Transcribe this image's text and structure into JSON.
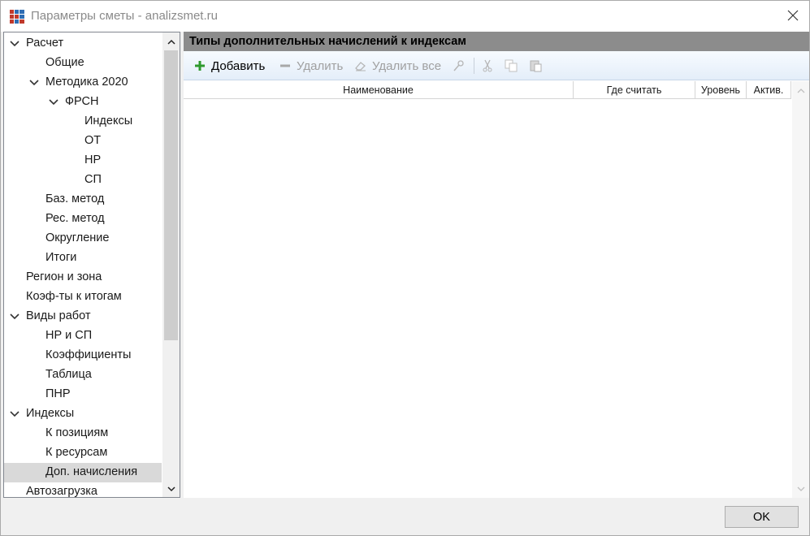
{
  "window": {
    "title": "Параметры сметы - analizsmet.ru",
    "app_icon": "table-grid-icon",
    "close_icon": "close-icon"
  },
  "tree": {
    "items": [
      {
        "label": "Расчет",
        "level": 0,
        "expandable": true,
        "expanded": true,
        "selected": false
      },
      {
        "label": "Общие",
        "level": 1,
        "expandable": false,
        "selected": false
      },
      {
        "label": "Методика 2020",
        "level": 1,
        "expandable": true,
        "expanded": true,
        "selected": false
      },
      {
        "label": "ФРСН",
        "level": 2,
        "expandable": true,
        "expanded": true,
        "selected": false
      },
      {
        "label": "Индексы",
        "level": 3,
        "expandable": false,
        "selected": false
      },
      {
        "label": "ОТ",
        "level": 3,
        "expandable": false,
        "selected": false
      },
      {
        "label": "НР",
        "level": 3,
        "expandable": false,
        "selected": false
      },
      {
        "label": "СП",
        "level": 3,
        "expandable": false,
        "selected": false
      },
      {
        "label": "Баз. метод",
        "level": 1,
        "expandable": false,
        "selected": false
      },
      {
        "label": "Рес. метод",
        "level": 1,
        "expandable": false,
        "selected": false
      },
      {
        "label": "Округление",
        "level": 1,
        "expandable": false,
        "selected": false
      },
      {
        "label": "Итоги",
        "level": 1,
        "expandable": false,
        "selected": false
      },
      {
        "label": "Регион и зона",
        "level": 0,
        "expandable": false,
        "selected": false
      },
      {
        "label": "Коэф-ты к итогам",
        "level": 0,
        "expandable": false,
        "selected": false
      },
      {
        "label": "Виды работ",
        "level": 0,
        "expandable": true,
        "expanded": true,
        "selected": false
      },
      {
        "label": "НР и СП",
        "level": 1,
        "expandable": false,
        "selected": false
      },
      {
        "label": "Коэффициенты",
        "level": 1,
        "expandable": false,
        "selected": false
      },
      {
        "label": "Таблица",
        "level": 1,
        "expandable": false,
        "selected": false
      },
      {
        "label": "ПНР",
        "level": 1,
        "expandable": false,
        "selected": false
      },
      {
        "label": "Индексы",
        "level": 0,
        "expandable": true,
        "expanded": true,
        "selected": false
      },
      {
        "label": "К позициям",
        "level": 1,
        "expandable": false,
        "selected": false
      },
      {
        "label": "К ресурсам",
        "level": 1,
        "expandable": false,
        "selected": false
      },
      {
        "label": "Доп. начисления",
        "level": 1,
        "expandable": false,
        "selected": true
      },
      {
        "label": "Автозагрузка",
        "level": 0,
        "expandable": false,
        "selected": false
      }
    ]
  },
  "panel": {
    "header": "Типы дополнительных начислений к индексам",
    "toolbar": {
      "add_label": "Добавить",
      "delete_label": "Удалить",
      "delete_all_label": "Удалить все",
      "add_icon": "plus-icon",
      "delete_icon": "minus-icon",
      "delete_all_icon": "eraser-icon",
      "clear_format_icon": "brush-icon",
      "cut_icon": "scissors-icon",
      "copy_icon": "copy-icon",
      "paste_icon": "paste-icon"
    },
    "columns": [
      "Наименование",
      "Где считать",
      "Уровень",
      "Актив."
    ],
    "rows": []
  },
  "footer": {
    "ok_label": "OK"
  },
  "colors": {
    "header_bg": "#8c8c8c",
    "selected_bg": "#d9d9d9",
    "add_green": "#2e9a2e"
  }
}
